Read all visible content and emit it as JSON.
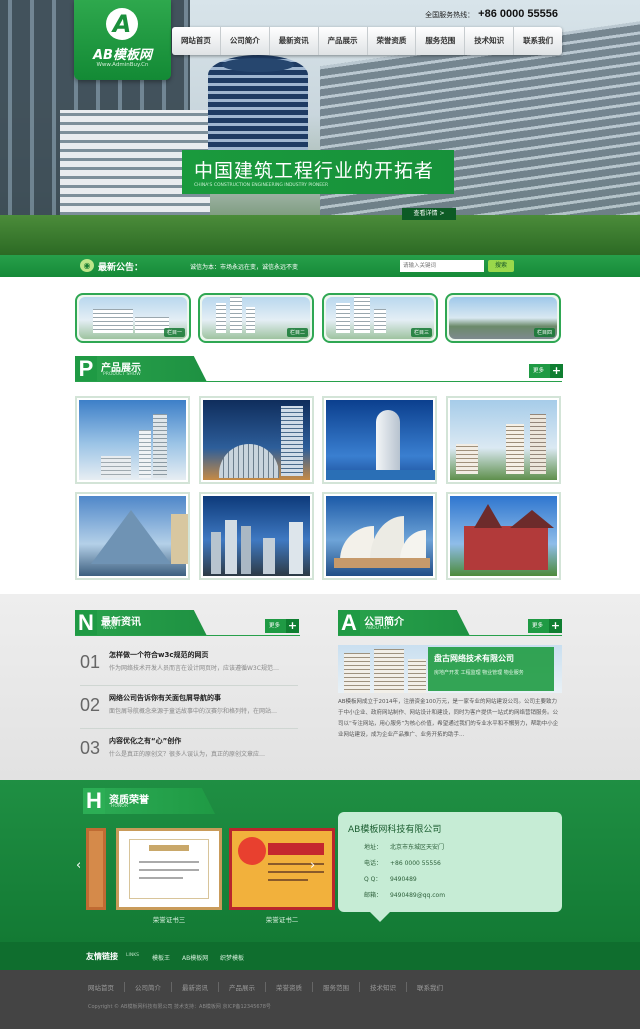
{
  "header": {
    "logo_letter": "A",
    "logo_name": "AB模板网",
    "logo_url": "Www.AdminBuy.Cn",
    "hotline_label": "全国服务热线：",
    "hotline_number": "+86 0000 55556"
  },
  "nav": [
    "网站首页",
    "公司简介",
    "最新资讯",
    "产品展示",
    "荣誉资质",
    "服务范围",
    "技术知识",
    "联系我们"
  ],
  "banner": {
    "title": "中国建筑工程行业的开拓者",
    "subtitle": "CHINA'S CONSTRUCTION ENGINEERING INDUSTRY PIONEER",
    "more": "查看详情 >"
  },
  "notice": {
    "label": "最新公告：",
    "text": "诚信为本：市场永远在变，诚信永远不变",
    "search_placeholder": "请输入关键词",
    "search_button": "搜索"
  },
  "features": [
    "栏目一",
    "栏目二",
    "栏目三",
    "栏目四"
  ],
  "products_section": {
    "letter": "P",
    "title": "产品展示",
    "en": "PRODUCT SHOW",
    "more": "更多"
  },
  "news_section": {
    "letter": "N",
    "title": "最新资讯",
    "en": "NEWS",
    "more": "更多",
    "items": [
      {
        "num": "01",
        "title": "怎样做一个符合w3c规范的网页",
        "desc": "作为网络技术开发人员而言在设计网页时，应该遵循W3C规范…"
      },
      {
        "num": "02",
        "title": "网络公司告诉你有关面包屑导航的事",
        "desc": "面包屑导航概念来源于童话故事中的汉赛尔和格列特，在网站…"
      },
      {
        "num": "03",
        "title": "内容优化之有“心”创作",
        "desc": "什么是真正的原创文？很多人误认为，真正的原创文章应…"
      }
    ]
  },
  "about_section": {
    "letter": "A",
    "title": "公司简介",
    "en": "ABOUT US",
    "more": "更多",
    "company": "盘古网络技术有限公司",
    "tags": "房地产开发 工程监理 物业管理 物业服务",
    "text": "AB模板网成立于2014年，注册资金100万元，是一家专业的网站建设公司。公司主要致力于中小企业、政府网站制作、网站设计和建设，同时为客户提供一站式的网络营销服务。公司以“专注网站，用心服务”为核心价值，希望通过我们的专业水平和不懈努力，帮助中小企业网站建设，成为企业产品推广、业务开拓的助手…"
  },
  "honor_section": {
    "letter": "H",
    "title": "资质荣誉",
    "en": "HONOR",
    "certs": [
      "荣誉证书三",
      "荣誉证书二"
    ]
  },
  "contact": {
    "company": "AB模板网科技有限公司",
    "address_label": "地址：",
    "address": "北京市东城区天安门",
    "phone_label": "电话：",
    "phone": "+86 0000 55556",
    "qq_label": "Q Q：",
    "qq": "9490489",
    "email_label": "邮箱：",
    "email": "9490489@qq.com"
  },
  "links": {
    "title": "友情链接",
    "en": "LINKS",
    "items": [
      "模板王",
      "AB模板网",
      "织梦模板"
    ]
  },
  "footer": {
    "nav": [
      "网站首页",
      "公司简介",
      "最新资讯",
      "产品展示",
      "荣誉资质",
      "服务范围",
      "技术知识",
      "联系我们"
    ],
    "copyright": "Copyright © AB模板网科技有限公司 技术支持：AB模板网 京ICP备12345678号"
  },
  "colors": {
    "brand": "#1f9a44",
    "brand_dark": "#0f6e2e",
    "footer_bg": "#444444"
  }
}
